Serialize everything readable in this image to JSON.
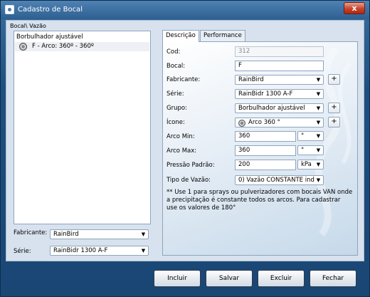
{
  "window": {
    "title": "Cadastro de Bocal"
  },
  "tree": {
    "caption": "Bocal\\ Vazão",
    "root": "Borbulhador ajustável",
    "child": "F - Arco: 360º - 360º"
  },
  "filters": {
    "fabricante_label": "Fabricante:",
    "fabricante_value": "RainBird",
    "serie_label": "Série:",
    "serie_value": "RainBidr 1300 A-F"
  },
  "tabs": [
    {
      "label": "Descrição"
    },
    {
      "label": "Performance"
    }
  ],
  "form": {
    "cod_label": "Cod:",
    "cod_value": "312",
    "bocal_label": "Bocal:",
    "bocal_value": "F",
    "fabricante_label": "Fabricante:",
    "fabricante_value": "RainBird",
    "serie_label": "Série:",
    "serie_value": "RainBidr 1300 A-F",
    "grupo_label": "Grupo:",
    "grupo_value": "Borbulhador ajustável",
    "icone_label": "Ícone:",
    "icone_value": "Arco 360 °",
    "arco_min_label": "Arco Min:",
    "arco_min_value": "360",
    "arco_min_unit": "°",
    "arco_max_label": "Arco Max:",
    "arco_max_value": "360",
    "arco_max_unit": "°",
    "pressao_label": "Pressão Padrão:",
    "pressao_value": "200",
    "pressao_unit": "kPa",
    "tipo_label": "Tipo de Vazão:",
    "tipo_value": "0) Vazão CONSTANTE ind",
    "note": "** Use 1 para sprays ou pulverizadores com bocais VAN onde a precipitação é constante todos os arcos. Para cadastrar use os valores de 180°"
  },
  "plus_label": "+",
  "buttons": {
    "incluir": "Incluir",
    "salvar": "Salvar",
    "excluir": "Excluir",
    "fechar": "Fechar"
  },
  "close_glyph": "x",
  "dropdown_arrow": "▼",
  "colors": {
    "title_bar": "#2d5f90",
    "frame": "#1a4674",
    "close": "#c7442c",
    "panel": "#d7e2ee"
  }
}
